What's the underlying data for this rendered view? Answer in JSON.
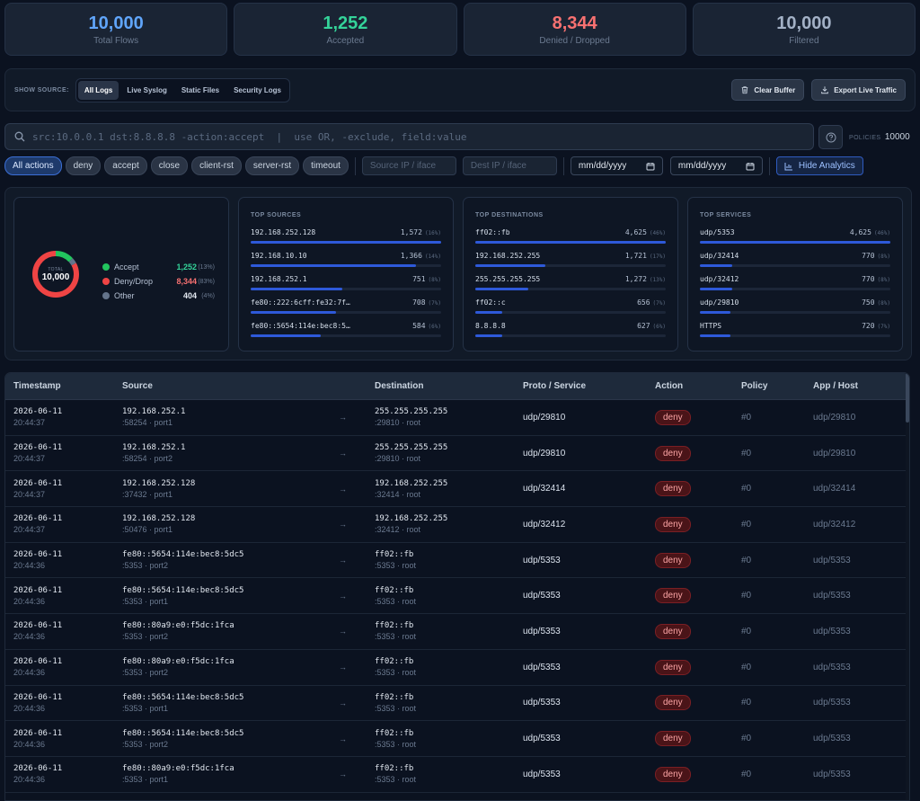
{
  "stats": [
    {
      "value": "10,000",
      "label": "Total Flows",
      "color": "#60a5fa"
    },
    {
      "value": "1,252",
      "label": "Accepted",
      "color": "#34d399"
    },
    {
      "value": "8,344",
      "label": "Denied / Dropped",
      "color": "#f87171"
    },
    {
      "value": "10,000",
      "label": "Filtered",
      "color": "#a3b1c6"
    }
  ],
  "source_bar": {
    "label": "SHOW SOURCE:",
    "segments": [
      "All Logs",
      "Live Syslog",
      "Static Files",
      "Security Logs"
    ],
    "active": "All Logs",
    "clear_label": "Clear Buffer",
    "export_label": "Export Live Traffic"
  },
  "search": {
    "placeholder": "src:10.0.0.1 dst:8.8.8.8 -action:accept  |  use OR, -exclude, field:value",
    "policies_label": "POLICIES",
    "policies_count": "10000"
  },
  "filters": {
    "actions": [
      "All actions",
      "deny",
      "accept",
      "close",
      "client-rst",
      "server-rst",
      "timeout"
    ],
    "active_action": "All actions",
    "source_placeholder": "Source IP / iface",
    "dest_placeholder": "Dest IP / iface",
    "date_from": "mm/dd/yyyy",
    "date_to": "mm/dd/yyyy",
    "analytics_label": "Hide Analytics"
  },
  "analytics": {
    "donut": {
      "total_label": "TOTAL",
      "total_value": "10,000",
      "items": [
        {
          "name": "Accept",
          "value": "1,252",
          "pct": "(13%)",
          "color": "#22c55e",
          "frac": 0.13
        },
        {
          "name": "Deny/Drop",
          "value": "8,344",
          "pct": "(83%)",
          "color": "#ef4444",
          "frac": 0.83
        },
        {
          "name": "Other",
          "value": "404",
          "pct": "(4%)",
          "color": "#64748b",
          "frac": 0.04
        }
      ]
    },
    "top_sources": {
      "title": "TOP SOURCES",
      "rows": [
        {
          "name": "192.168.252.128",
          "count": "1,572",
          "pct": "(16%)",
          "frac": 1.0
        },
        {
          "name": "192.168.10.10",
          "count": "1,366",
          "pct": "(14%)",
          "frac": 0.87
        },
        {
          "name": "192.168.252.1",
          "count": "751",
          "pct": "(8%)",
          "frac": 0.48
        },
        {
          "name": "fe80::222:6cff:fe32:7f…",
          "count": "708",
          "pct": "(7%)",
          "frac": 0.45
        },
        {
          "name": "fe80::5654:114e:bec8:5…",
          "count": "584",
          "pct": "(6%)",
          "frac": 0.37
        }
      ]
    },
    "top_destinations": {
      "title": "TOP DESTINATIONS",
      "rows": [
        {
          "name": "ff02::fb",
          "count": "4,625",
          "pct": "(46%)",
          "frac": 1.0
        },
        {
          "name": "192.168.252.255",
          "count": "1,721",
          "pct": "(17%)",
          "frac": 0.37
        },
        {
          "name": "255.255.255.255",
          "count": "1,272",
          "pct": "(13%)",
          "frac": 0.28
        },
        {
          "name": "ff02::c",
          "count": "656",
          "pct": "(7%)",
          "frac": 0.14
        },
        {
          "name": "8.8.8.8",
          "count": "627",
          "pct": "(6%)",
          "frac": 0.14
        }
      ]
    },
    "top_services": {
      "title": "TOP SERVICES",
      "rows": [
        {
          "name": "udp/5353",
          "count": "4,625",
          "pct": "(46%)",
          "frac": 1.0
        },
        {
          "name": "udp/32414",
          "count": "770",
          "pct": "(8%)",
          "frac": 0.17
        },
        {
          "name": "udp/32412",
          "count": "770",
          "pct": "(8%)",
          "frac": 0.17
        },
        {
          "name": "udp/29810",
          "count": "750",
          "pct": "(8%)",
          "frac": 0.16
        },
        {
          "name": "HTTPS",
          "count": "720",
          "pct": "(7%)",
          "frac": 0.16
        }
      ]
    }
  },
  "table": {
    "headers": [
      "Timestamp",
      "Source",
      "",
      "Destination",
      "Proto / Service",
      "Action",
      "Policy",
      "App / Host"
    ],
    "arrow": "→",
    "rows": [
      {
        "date": "2026-06-11",
        "time": "20:44:37",
        "src": "192.168.252.1",
        "src_sub": ":58254 · port1",
        "dst": "255.255.255.255",
        "dst_sub": ":29810 · root",
        "proto": "udp/29810",
        "action": "deny",
        "policy": "#0",
        "app": "udp/29810"
      },
      {
        "date": "2026-06-11",
        "time": "20:44:37",
        "src": "192.168.252.1",
        "src_sub": ":58254 · port2",
        "dst": "255.255.255.255",
        "dst_sub": ":29810 · root",
        "proto": "udp/29810",
        "action": "deny",
        "policy": "#0",
        "app": "udp/29810"
      },
      {
        "date": "2026-06-11",
        "time": "20:44:37",
        "src": "192.168.252.128",
        "src_sub": ":37432 · port1",
        "dst": "192.168.252.255",
        "dst_sub": ":32414 · root",
        "proto": "udp/32414",
        "action": "deny",
        "policy": "#0",
        "app": "udp/32414"
      },
      {
        "date": "2026-06-11",
        "time": "20:44:37",
        "src": "192.168.252.128",
        "src_sub": ":50476 · port1",
        "dst": "192.168.252.255",
        "dst_sub": ":32412 · root",
        "proto": "udp/32412",
        "action": "deny",
        "policy": "#0",
        "app": "udp/32412"
      },
      {
        "date": "2026-06-11",
        "time": "20:44:36",
        "src": "fe80::5654:114e:bec8:5dc5",
        "src_sub": ":5353 · port2",
        "dst": "ff02::fb",
        "dst_sub": ":5353 · root",
        "proto": "udp/5353",
        "action": "deny",
        "policy": "#0",
        "app": "udp/5353"
      },
      {
        "date": "2026-06-11",
        "time": "20:44:36",
        "src": "fe80::5654:114e:bec8:5dc5",
        "src_sub": ":5353 · port1",
        "dst": "ff02::fb",
        "dst_sub": ":5353 · root",
        "proto": "udp/5353",
        "action": "deny",
        "policy": "#0",
        "app": "udp/5353"
      },
      {
        "date": "2026-06-11",
        "time": "20:44:36",
        "src": "fe80::80a9:e0:f5dc:1fca",
        "src_sub": ":5353 · port2",
        "dst": "ff02::fb",
        "dst_sub": ":5353 · root",
        "proto": "udp/5353",
        "action": "deny",
        "policy": "#0",
        "app": "udp/5353"
      },
      {
        "date": "2026-06-11",
        "time": "20:44:36",
        "src": "fe80::80a9:e0:f5dc:1fca",
        "src_sub": ":5353 · port2",
        "dst": "ff02::fb",
        "dst_sub": ":5353 · root",
        "proto": "udp/5353",
        "action": "deny",
        "policy": "#0",
        "app": "udp/5353"
      },
      {
        "date": "2026-06-11",
        "time": "20:44:36",
        "src": "fe80::5654:114e:bec8:5dc5",
        "src_sub": ":5353 · port1",
        "dst": "ff02::fb",
        "dst_sub": ":5353 · root",
        "proto": "udp/5353",
        "action": "deny",
        "policy": "#0",
        "app": "udp/5353"
      },
      {
        "date": "2026-06-11",
        "time": "20:44:36",
        "src": "fe80::5654:114e:bec8:5dc5",
        "src_sub": ":5353 · port2",
        "dst": "ff02::fb",
        "dst_sub": ":5353 · root",
        "proto": "udp/5353",
        "action": "deny",
        "policy": "#0",
        "app": "udp/5353"
      },
      {
        "date": "2026-06-11",
        "time": "20:44:36",
        "src": "fe80::80a9:e0:f5dc:1fca",
        "src_sub": ":5353 · port1",
        "dst": "ff02::fb",
        "dst_sub": ":5353 · root",
        "proto": "udp/5353",
        "action": "deny",
        "policy": "#0",
        "app": "udp/5353"
      }
    ]
  }
}
